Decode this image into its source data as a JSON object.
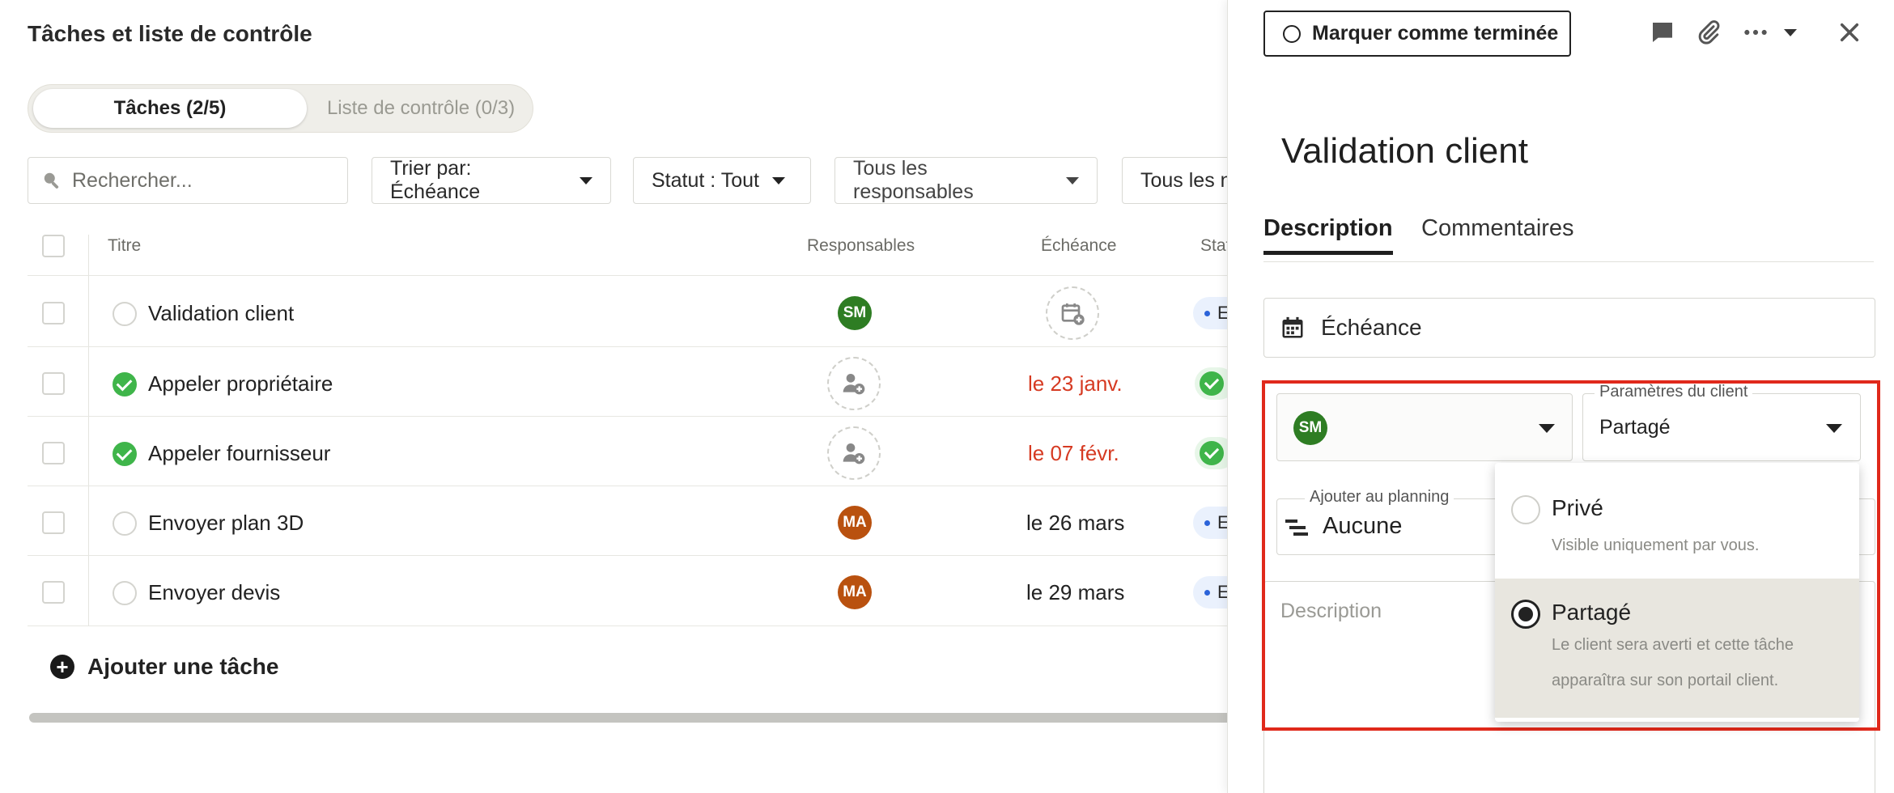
{
  "page": {
    "title": "Tâches et liste de contrôle"
  },
  "segments": {
    "tasks": "Tâches (2/5)",
    "checklist": "Liste de contrôle (0/3)"
  },
  "search": {
    "placeholder": "Rechercher..."
  },
  "filters": {
    "sort": "Trier par: Échéance",
    "status": "Statut : Tout",
    "assignees": "Tous les responsables",
    "other": "Tous les n"
  },
  "table": {
    "headers": {
      "title": "Titre",
      "assignees": "Responsables",
      "due": "Échéance",
      "status": "Stat"
    },
    "rows": [
      {
        "title": "Validation client",
        "done": false,
        "assignee": "SM",
        "due": "",
        "status": "E"
      },
      {
        "title": "Appeler propriétaire",
        "done": true,
        "assignee": "",
        "due": "le 23 janv.",
        "status": ""
      },
      {
        "title": "Appeler fournisseur",
        "done": true,
        "assignee": "",
        "due": "le 07 févr.",
        "status": ""
      },
      {
        "title": "Envoyer plan 3D",
        "done": false,
        "assignee": "MA",
        "due": "le 26 mars",
        "status": "E"
      },
      {
        "title": "Envoyer devis",
        "done": false,
        "assignee": "MA",
        "due": "le 29 mars",
        "status": "E"
      }
    ]
  },
  "add_task": "Ajouter une tâche",
  "detail": {
    "mark_done": "Marquer comme terminée",
    "title": "Validation client",
    "tabs": {
      "description": "Description",
      "comments": "Commentaires"
    },
    "due_label": "Échéance",
    "assignee_initials": "SM",
    "client_settings_label": "Paramètres du client",
    "client_settings_value": "Partagé",
    "planning_label": "Ajouter au planning",
    "planning_value": "Aucune",
    "description_placeholder": "Description",
    "menu": {
      "private_label": "Privé",
      "private_sub": "Visible uniquement par vous.",
      "shared_label": "Partagé",
      "shared_sub": "Le client sera averti et cette tâche apparaîtra sur son portail client."
    }
  },
  "colors": {
    "late": "#d63a22",
    "done": "#3fb54a",
    "highlight": "#e0291b",
    "avatar_sm": "#2e7d23",
    "avatar_ma": "#b9510f"
  },
  "icons": [
    "search-icon",
    "caret-down-icon",
    "check-icon",
    "calendar-add-icon",
    "user-add-icon",
    "plus-icon",
    "comment-icon",
    "paperclip-icon",
    "more-icon",
    "close-icon",
    "calendar-icon",
    "gantt-icon"
  ]
}
